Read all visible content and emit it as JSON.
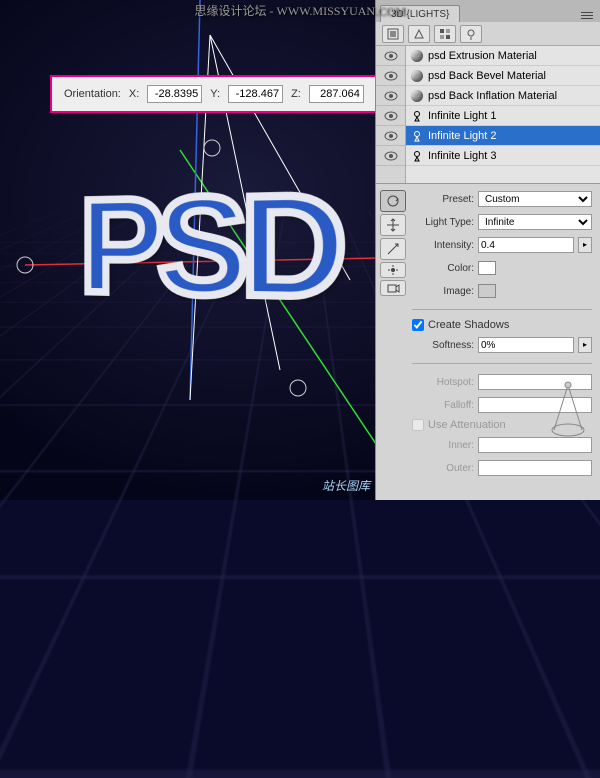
{
  "watermarks": {
    "top": "思缘设计论坛 - WWW.MISSYUAN.COM",
    "bottom": "站长图库"
  },
  "viewport_text": "PSD",
  "orientation": {
    "label": "Orientation:",
    "x_label": "X:",
    "x": "-28.8395",
    "y_label": "Y:",
    "y": "-128.467",
    "z_label": "Z:",
    "z": "287.064"
  },
  "panel": {
    "tab": "3D {LIGHTS}",
    "items": [
      {
        "label": "psd Extrusion Material",
        "type": "mat"
      },
      {
        "label": "psd Back Bevel Material",
        "type": "mat"
      },
      {
        "label": "psd Back Inflation Material",
        "type": "mat"
      },
      {
        "label": "Infinite Light 1",
        "type": "light"
      },
      {
        "label": "Infinite Light 2",
        "type": "light",
        "selected": true
      },
      {
        "label": "Infinite Light 3",
        "type": "light"
      }
    ]
  },
  "props": {
    "preset_label": "Preset:",
    "preset": "Custom",
    "lighttype_label": "Light Type:",
    "lighttype": "Infinite",
    "intensity_label": "Intensity:",
    "intensity": "0.4",
    "color_label": "Color:",
    "color": "#ffffff",
    "image_label": "Image:",
    "shadows_label": "Create Shadows",
    "shadows": true,
    "softness_label": "Softness:",
    "softness": "0%",
    "hotspot_label": "Hotspot:",
    "falloff_label": "Falloff:",
    "atten_label": "Use Attenuation",
    "atten": false,
    "inner_label": "Inner:",
    "outer_label": "Outer:"
  }
}
